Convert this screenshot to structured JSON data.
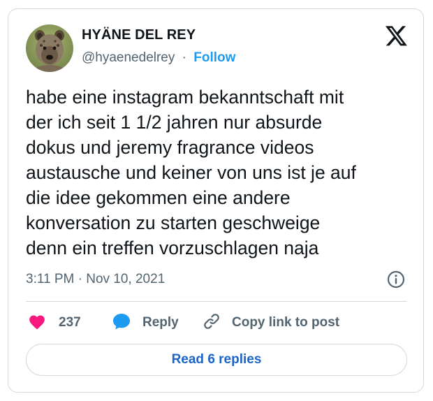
{
  "author": {
    "name": "HYÄNE DEL REY",
    "handle": "@hyaenedelrey",
    "separator": "·",
    "follow_label": "Follow",
    "avatar_icon": "hyena-avatar"
  },
  "logo": {
    "icon": "x-logo-icon"
  },
  "tweet": {
    "text": "habe eine instagram bekanntschaft mit\nder ich seit 1 1/2 jahren nur absurde\ndokus und jeremy fragrance videos\naustausche und keiner von uns ist je auf\ndie idee gekommen eine andere\nkonversation zu starten geschweige\ndenn ein treffen vorzuschlagen naja",
    "timestamp": "3:11 PM · Nov 10, 2021"
  },
  "actions": {
    "like_count": "237",
    "reply_label": "Reply",
    "copy_link_label": "Copy link to post"
  },
  "read_replies_label": "Read 6 replies",
  "colors": {
    "accent": "#1d9bf0",
    "heart": "#f91880",
    "secondary_text": "#536471",
    "border": "#cfd9de"
  }
}
